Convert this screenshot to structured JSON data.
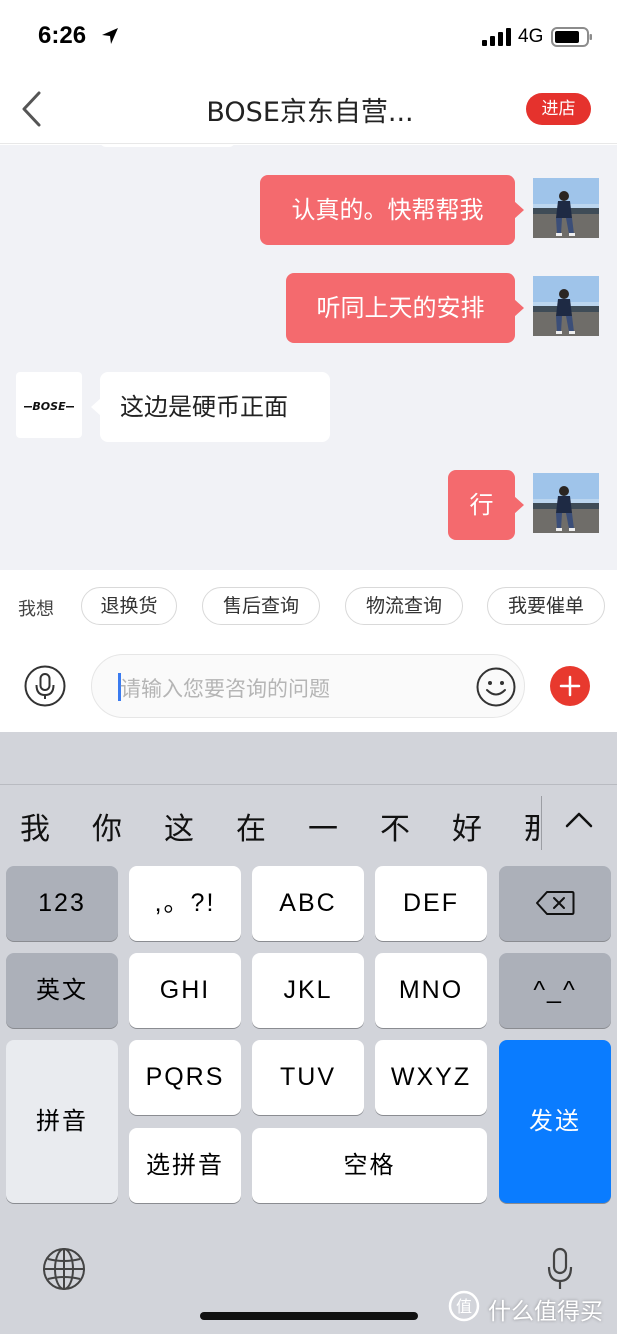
{
  "status_bar": {
    "time": "6:26",
    "network": "4G"
  },
  "nav": {
    "title": "BOSE京东自营...",
    "store_button": "进店"
  },
  "messages": [
    {
      "from": "me",
      "text": "认真的。快帮帮我"
    },
    {
      "from": "me",
      "text": "听同上天的安排"
    },
    {
      "from": "shop",
      "text": "这边是硬币正面"
    },
    {
      "from": "me",
      "text": "行"
    }
  ],
  "shop_avatar_logo": "BOSE",
  "quick_replies": {
    "label": "我想",
    "items": [
      "退换货",
      "售后查询",
      "物流查询",
      "我要催单"
    ]
  },
  "input": {
    "placeholder": "请输入您要咨询的问题"
  },
  "keyboard": {
    "candidates": [
      "我",
      "你",
      "这",
      "在",
      "一",
      "不",
      "好",
      "那"
    ],
    "keys": {
      "num": "123",
      "punct": ",。?!",
      "abc": "ABC",
      "def": "DEF",
      "english": "英文",
      "ghi": "GHI",
      "jkl": "JKL",
      "mno": "MNO",
      "face": "^_^",
      "pinyin": "拼音",
      "pqrs": "PQRS",
      "tuv": "TUV",
      "wxyz": "WXYZ",
      "send": "发送",
      "select_pinyin": "选拼音",
      "space": "空格"
    }
  },
  "watermark": "什么值得买",
  "colors": {
    "accent_red": "#e5322d",
    "bubble_me": "#f46a6e",
    "send_blue": "#0a7cff",
    "chat_bg": "#f1f2f6"
  },
  "icons": [
    "location-arrow-icon",
    "signal-icon",
    "battery-icon",
    "back-chevron-icon",
    "voice-icon",
    "emoji-icon",
    "plus-icon",
    "delete-icon",
    "chevron-up-icon",
    "globe-icon",
    "keyboard-mic-icon"
  ]
}
